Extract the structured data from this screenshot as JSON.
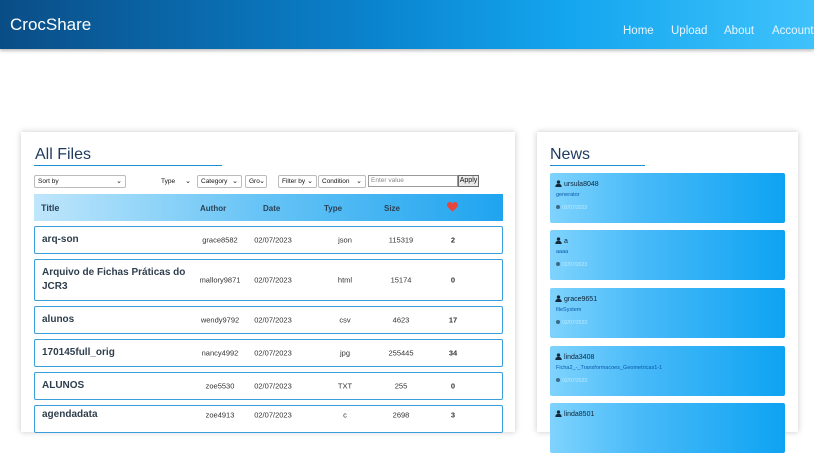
{
  "navbar": {
    "brand": "CrocShare",
    "links": [
      "Home",
      "Upload",
      "About",
      "Account"
    ]
  },
  "files": {
    "title": "All Files",
    "filters": {
      "sort_by": "Sort by",
      "type": "Type",
      "category": "Category",
      "group": "Gro",
      "filter_by": "Filter by",
      "condition": "Condition",
      "value_placeholder": "Enter value",
      "apply": "Apply"
    },
    "columns": [
      "Title",
      "Author",
      "Date",
      "Type",
      "Size"
    ],
    "rows": [
      {
        "title": "arq-son",
        "author": "grace8582",
        "date": "02/07/2023",
        "type": "json",
        "size": "115319",
        "likes": "2"
      },
      {
        "title": "Arquivo de Fichas Práticas do JCR3",
        "author": "mallory9871",
        "date": "02/07/2023",
        "type": "html",
        "size": "15174",
        "likes": "0"
      },
      {
        "title": "alunos",
        "author": "wendy9792",
        "date": "02/07/2023",
        "type": "csv",
        "size": "4623",
        "likes": "17"
      },
      {
        "title": "170145full_orig",
        "author": "nancy4992",
        "date": "02/07/2023",
        "type": "jpg",
        "size": "255445",
        "likes": "34"
      },
      {
        "title": "ALUNOS",
        "author": "zoe5530",
        "date": "02/07/2023",
        "type": "TXT",
        "size": "255",
        "likes": "0"
      },
      {
        "title": "agendadata",
        "author": "zoe4913",
        "date": "02/07/2023",
        "type": "c",
        "size": "2698",
        "likes": "3"
      }
    ]
  },
  "news": {
    "title": "News",
    "items": [
      {
        "user": "ursula8048",
        "file": "generator",
        "date": "02/07/2023"
      },
      {
        "user": "a",
        "file": "aaaa",
        "date": "02/07/2023"
      },
      {
        "user": "grace9651",
        "file": "fileSystem",
        "date": "02/07/2023"
      },
      {
        "user": "linda3408",
        "file": "Ficha2_-_Transformacoes_Geometricas1-1",
        "date": "02/07/2023"
      },
      {
        "user": "linda8501",
        "file": "",
        "date": ""
      }
    ]
  },
  "colors": {
    "navbar_start": "#0a4d86",
    "navbar_end": "#3fc2fb",
    "row_border": "#3a9edb",
    "heart": "#e8453c"
  }
}
